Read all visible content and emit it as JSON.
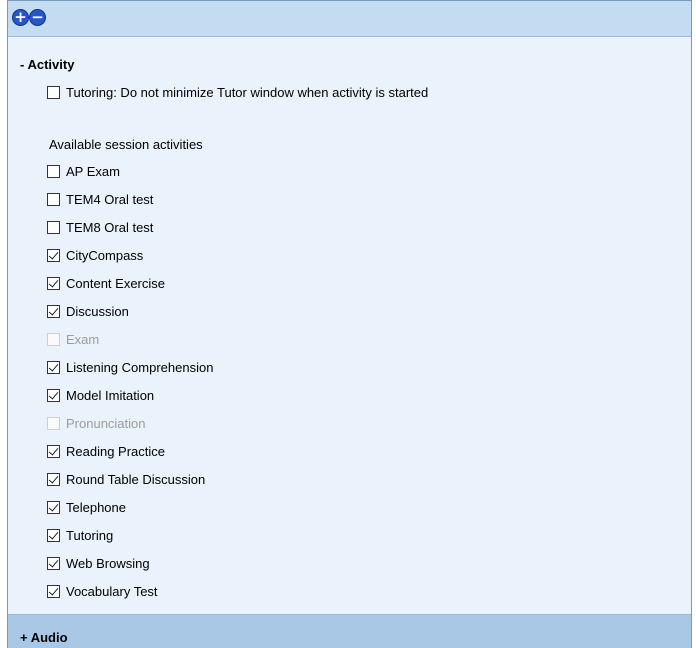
{
  "toolbar": {
    "expand_icon": "plus-circle-icon",
    "collapse_icon": "minus-circle-icon",
    "expand_glyph": "+",
    "collapse_glyph": "−"
  },
  "activity": {
    "header": "- Activity",
    "tutoring_option": {
      "label": "Tutoring: Do not minimize Tutor window when activity is started",
      "checked": false
    },
    "available_label": "Available session activities",
    "items": [
      {
        "label": "AP Exam",
        "checked": false,
        "enabled": true
      },
      {
        "label": "TEM4 Oral test",
        "checked": false,
        "enabled": true
      },
      {
        "label": "TEM8 Oral test",
        "checked": false,
        "enabled": true
      },
      {
        "label": "CityCompass",
        "checked": true,
        "enabled": true
      },
      {
        "label": "Content Exercise",
        "checked": true,
        "enabled": true
      },
      {
        "label": "Discussion",
        "checked": true,
        "enabled": true
      },
      {
        "label": "Exam",
        "checked": false,
        "enabled": false
      },
      {
        "label": "Listening Comprehension",
        "checked": true,
        "enabled": true
      },
      {
        "label": "Model Imitation",
        "checked": true,
        "enabled": true
      },
      {
        "label": "Pronunciation",
        "checked": false,
        "enabled": false
      },
      {
        "label": "Reading Practice",
        "checked": true,
        "enabled": true
      },
      {
        "label": "Round Table Discussion",
        "checked": true,
        "enabled": true
      },
      {
        "label": "Telephone",
        "checked": true,
        "enabled": true
      },
      {
        "label": "Tutoring",
        "checked": true,
        "enabled": true
      },
      {
        "label": "Web Browsing",
        "checked": true,
        "enabled": true
      },
      {
        "label": "Vocabulary Test",
        "checked": true,
        "enabled": true
      }
    ]
  },
  "audio": {
    "header": "+ Audio"
  }
}
